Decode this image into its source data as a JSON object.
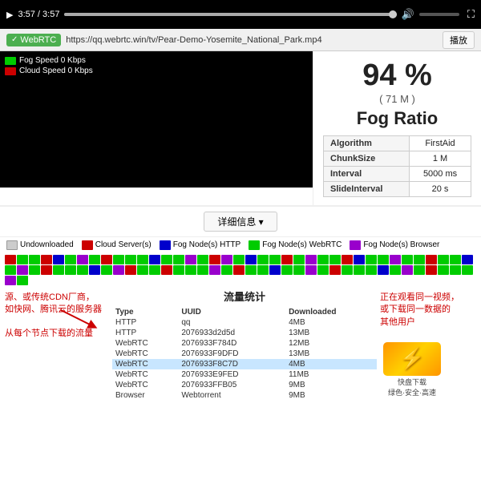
{
  "videoPlayer": {
    "time": "3:57 / 3:57",
    "playIcon": "▶",
    "volumeIcon": "🔊",
    "fullscreenIcon": "⛶"
  },
  "webrtcBar": {
    "badge": "WebRTC",
    "url": "https://qq.webrtc.win/tv/Pear-Demo-Yosemite_National_Park.mp4",
    "playBtn": "播放"
  },
  "fogStats": {
    "percentage": "94 %",
    "size": "( 71 M )",
    "title": "Fog Ratio",
    "algorithm": "FirstAid",
    "chunkSize": "1 M",
    "interval": "5000 ms",
    "slideInterval": "20 s"
  },
  "speedLegend": {
    "fogLabel": "Fog Speed 0 Kbps",
    "cloudLabel": "Cloud Speed 0 Kbps",
    "fogColor": "#00cc00",
    "cloudColor": "#cc0000"
  },
  "detailsBtn": "详细信息 ▾",
  "legendBar": {
    "items": [
      {
        "label": "Undownloaded",
        "color": "#cccccc"
      },
      {
        "label": "Cloud Server(s)",
        "color": "#cc0000"
      },
      {
        "label": "Fog Node(s) HTTP",
        "color": "#0000cc"
      },
      {
        "label": "Fog Node(s) WebRTC",
        "color": "#00cc00"
      },
      {
        "label": "Fog Node(s) Browser",
        "color": "#9900cc"
      }
    ]
  },
  "flowStats": {
    "title": "流量统计",
    "headers": [
      "Type",
      "UUID",
      "Downloaded"
    ],
    "rows": [
      {
        "type": "HTTP",
        "uuid": "qq",
        "downloaded": "4MB",
        "highlight": false
      },
      {
        "type": "HTTP",
        "uuid": "2076933d2d5d",
        "downloaded": "13MB",
        "highlight": false
      },
      {
        "type": "WebRTC",
        "uuid": "2076933F784D",
        "downloaded": "12MB",
        "highlight": false
      },
      {
        "type": "WebRTC",
        "uuid": "2076933F9DFD",
        "downloaded": "13MB",
        "highlight": false
      },
      {
        "type": "WebRTC",
        "uuid": "2076933F8C7D",
        "downloaded": "4MB",
        "highlight": true
      },
      {
        "type": "WebRTC",
        "uuid": "2076933E9FED",
        "downloaded": "11MB",
        "highlight": false
      },
      {
        "type": "WebRTC",
        "uuid": "2076933FFB05",
        "downloaded": "9MB",
        "highlight": false
      },
      {
        "type": "Browser",
        "uuid": "Webtorrent",
        "downloaded": "9MB",
        "highlight": false
      }
    ]
  },
  "annotations": {
    "leftTop": "源、或传统CDN厂商，\n如快网、腾讯云的服务器",
    "leftBottom": "从每个节点下载的流量",
    "rightTop": "正在观看同一视频，\n或下载同一数据的\n其他用户"
  },
  "watermark": {
    "icon": "⚡",
    "text": "快盘下载\n绿色·安全·高速"
  },
  "chunks": {
    "colors": [
      "#cc0000",
      "#00cc00",
      "#00cc00",
      "#cc0000",
      "#0000cc",
      "#00cc00",
      "#9900cc",
      "#00cc00",
      "#cc0000",
      "#00cc00",
      "#00cc00",
      "#00cc00",
      "#0000cc",
      "#00cc00",
      "#00cc00",
      "#9900cc",
      "#00cc00",
      "#cc0000",
      "#9900cc",
      "#00cc00",
      "#0000cc",
      "#00cc00",
      "#00cc00",
      "#cc0000",
      "#00cc00",
      "#9900cc",
      "#00cc00",
      "#00cc00",
      "#cc0000",
      "#0000cc",
      "#00cc00",
      "#00cc00",
      "#9900cc",
      "#00cc00",
      "#00cc00",
      "#cc0000",
      "#00cc00",
      "#00cc00",
      "#0000cc",
      "#00cc00",
      "#9900cc",
      "#00cc00",
      "#cc0000",
      "#00cc00",
      "#00cc00",
      "#00cc00",
      "#0000cc",
      "#00cc00",
      "#9900cc",
      "#cc0000",
      "#00cc00",
      "#00cc00",
      "#cc0000",
      "#00cc00",
      "#00cc00",
      "#00cc00",
      "#9900cc",
      "#00cc00",
      "#cc0000",
      "#00cc00",
      "#00cc00",
      "#0000cc",
      "#00cc00",
      "#00cc00",
      "#9900cc",
      "#00cc00",
      "#cc0000",
      "#00cc00",
      "#00cc00",
      "#00cc00",
      "#0000cc",
      "#00cc00",
      "#9900cc",
      "#00cc00",
      "#cc0000",
      "#00cc00",
      "#00cc00",
      "#00cc00",
      "#9900cc",
      "#00cc00"
    ]
  }
}
